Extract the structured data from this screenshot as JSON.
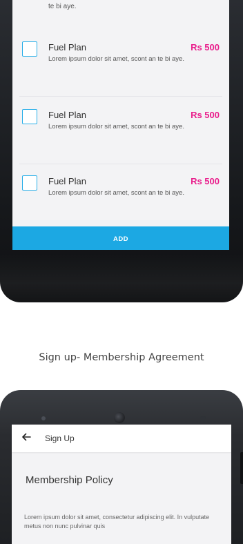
{
  "top_screen": {
    "cut_text": "te bi aye.",
    "plans": [
      {
        "title": "Fuel Plan",
        "price": "Rs 500",
        "description": "Lorem ipsum dolor sit amet, scont an te bi aye."
      },
      {
        "title": "Fuel Plan",
        "price": "Rs 500",
        "description": "Lorem ipsum dolor sit amet, scont an te bi aye."
      },
      {
        "title": "Fuel Plan",
        "price": "Rs 500",
        "description": "Lorem ipsum dolor sit amet, scont an te bi aye."
      }
    ],
    "add_label": "ADD"
  },
  "caption": "Sign up- Membership Agreement",
  "bottom_screen": {
    "app_bar_title": "Sign Up",
    "back_icon": "arrow-left-icon",
    "heading": "Membership Policy",
    "body": "Lorem ipsum dolor sit amet, consectetur adipiscing elit. In vulputate metus non nunc pulvinar quis"
  },
  "colors": {
    "accent_blue": "#1ca8e3",
    "price_pink": "#e91e8c",
    "screen_bg": "#f3f3f5"
  }
}
